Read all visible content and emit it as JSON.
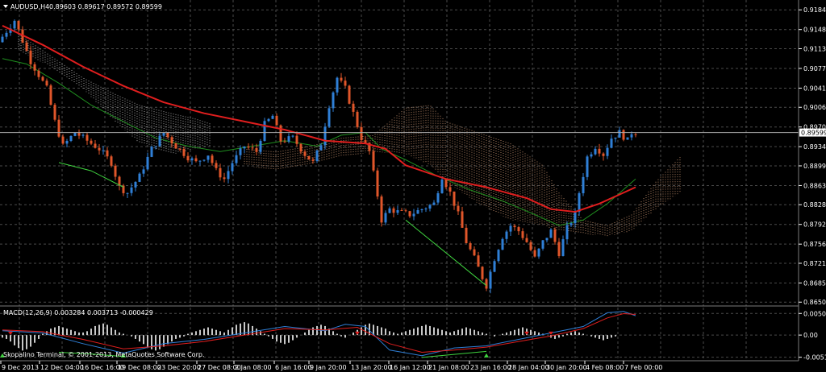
{
  "colors": {
    "background": "#000000",
    "grid": "#4a4a4a",
    "bull": "#2f7fd6",
    "bear": "#e0562a",
    "red_ma": "#e01e1e",
    "green_ma": "#1f8f1f",
    "cloud_a": "#c9c9c9",
    "cloud_b": "#d9a07a",
    "macd_line": "#2f7fd6",
    "signal_line": "#e01e1e",
    "histogram": "#c8c8c8",
    "divergence": "#3fd33f",
    "current_price_line": "#aaaaaa"
  },
  "header": {
    "menu_icon": "triangle-down-icon",
    "symbol": "AUDUSD,H4",
    "ohlc": "0.89603 0.89617 0.89572 0.89599"
  },
  "macd_label": "MACD(12,26,9) 0.003284 0.003713 -0.000429",
  "copyright": "Skopalino Terminal, © 2001-2013, MetaQuotes Software Corp.",
  "chart_data": {
    "type": "candlestick",
    "symbol": "AUDUSD",
    "timeframe": "H4",
    "price_axis_ticks": [
      "0.91840",
      "0.91480",
      "0.91130",
      "0.90770",
      "0.90410",
      "0.90060",
      "0.89700",
      "0.89340",
      "0.88990",
      "0.88630",
      "0.88280",
      "0.87920",
      "0.87560",
      "0.87210",
      "0.86850",
      "0.86500"
    ],
    "price_range": [
      0.8643,
      0.9202
    ],
    "current_price": "0.89599",
    "macd_axis_ticks": [
      "0.00504",
      "0.00",
      "-0.00516"
    ],
    "macd_range": [
      -0.0056,
      0.0064
    ],
    "time_axis_labels": [
      "9 Dec 2013",
      "12 Dec 04:00",
      "16 Dec 16:00",
      "19 Dec 08:00",
      "23 Dec 20:00",
      "27 Dec 08:00",
      "2 Jan 08:00",
      "6 Jan 16:00",
      "9 Jan 20:00",
      "13 Jan 20:00",
      "16 Jan 12:00",
      "21 Jan 08:00",
      "23 Jan 16:00",
      "28 Jan 04:00",
      "30 Jan 20:00",
      "4 Feb 08:00",
      "7 Feb 00:00"
    ],
    "price_path": [
      [
        0,
        0.9125
      ],
      [
        4,
        0.9165
      ],
      [
        8,
        0.909
      ],
      [
        12,
        0.904
      ],
      [
        14,
        0.898
      ],
      [
        16,
        0.8935
      ],
      [
        19,
        0.896
      ],
      [
        22,
        0.8945
      ],
      [
        25,
        0.893
      ],
      [
        28,
        0.8905
      ],
      [
        30,
        0.886
      ],
      [
        32,
        0.885
      ],
      [
        35,
        0.888
      ],
      [
        38,
        0.893
      ],
      [
        41,
        0.896
      ],
      [
        44,
        0.8935
      ],
      [
        47,
        0.8915
      ],
      [
        49,
        0.8905
      ],
      [
        52,
        0.892
      ],
      [
        54,
        0.889
      ],
      [
        56,
        0.8875
      ],
      [
        58,
        0.8905
      ],
      [
        61,
        0.8935
      ],
      [
        64,
        0.8925
      ],
      [
        66,
        0.8975
      ],
      [
        68,
        0.899
      ],
      [
        70,
        0.8945
      ],
      [
        73,
        0.895
      ],
      [
        76,
        0.892
      ],
      [
        78,
        0.8905
      ],
      [
        80,
        0.894
      ],
      [
        82,
        0.901
      ],
      [
        84,
        0.906
      ],
      [
        86,
        0.904
      ],
      [
        88,
        0.8995
      ],
      [
        90,
        0.895
      ],
      [
        92,
        0.8925
      ],
      [
        94,
        0.8845
      ],
      [
        95,
        0.88
      ],
      [
        97,
        0.882
      ],
      [
        99,
        0.8815
      ],
      [
        102,
        0.881
      ],
      [
        105,
        0.882
      ],
      [
        108,
        0.883
      ],
      [
        110,
        0.888
      ],
      [
        112,
        0.885
      ],
      [
        114,
        0.881
      ],
      [
        116,
        0.876
      ],
      [
        118,
        0.873
      ],
      [
        120,
        0.8695
      ],
      [
        121,
        0.868
      ],
      [
        123,
        0.873
      ],
      [
        125,
        0.877
      ],
      [
        127,
        0.879
      ],
      [
        129,
        0.878
      ],
      [
        131,
        0.876
      ],
      [
        133,
        0.873
      ],
      [
        135,
        0.876
      ],
      [
        137,
        0.878
      ],
      [
        139,
        0.874
      ],
      [
        141,
        0.8785
      ],
      [
        143,
        0.881
      ],
      [
        144,
        0.885
      ],
      [
        146,
        0.8915
      ],
      [
        148,
        0.8935
      ],
      [
        150,
        0.892
      ],
      [
        152,
        0.895
      ],
      [
        154,
        0.896
      ],
      [
        156,
        0.8945
      ],
      [
        157,
        0.896
      ]
    ],
    "red_ma": [
      [
        0,
        0.9155
      ],
      [
        10,
        0.912
      ],
      [
        20,
        0.908
      ],
      [
        30,
        0.9045
      ],
      [
        40,
        0.9015
      ],
      [
        50,
        0.8995
      ],
      [
        60,
        0.898
      ],
      [
        70,
        0.8965
      ],
      [
        80,
        0.8945
      ],
      [
        90,
        0.894
      ],
      [
        95,
        0.893
      ],
      [
        100,
        0.89
      ],
      [
        110,
        0.8875
      ],
      [
        120,
        0.886
      ],
      [
        130,
        0.884
      ],
      [
        136,
        0.882
      ],
      [
        142,
        0.8815
      ],
      [
        148,
        0.883
      ],
      [
        157,
        0.886
      ]
    ],
    "green_ma": [
      [
        0,
        0.9095
      ],
      [
        6,
        0.9085
      ],
      [
        14,
        0.905
      ],
      [
        22,
        0.901
      ],
      [
        30,
        0.898
      ],
      [
        38,
        0.895
      ],
      [
        46,
        0.8935
      ],
      [
        54,
        0.8925
      ],
      [
        62,
        0.8935
      ],
      [
        70,
        0.8945
      ],
      [
        78,
        0.8935
      ],
      [
        84,
        0.8955
      ],
      [
        90,
        0.896
      ],
      [
        94,
        0.893
      ],
      [
        100,
        0.891
      ],
      [
        108,
        0.888
      ],
      [
        116,
        0.8855
      ],
      [
        124,
        0.8835
      ],
      [
        132,
        0.881
      ],
      [
        138,
        0.879
      ],
      [
        144,
        0.88
      ],
      [
        150,
        0.883
      ],
      [
        157,
        0.8875
      ]
    ],
    "cloud_a_upper": [
      [
        4,
        0.914
      ],
      [
        12,
        0.91
      ],
      [
        20,
        0.906
      ],
      [
        28,
        0.903
      ],
      [
        34,
        0.901
      ],
      [
        42,
        0.8995
      ],
      [
        48,
        0.8985
      ],
      [
        52,
        0.8975
      ]
    ],
    "cloud_a_lower": [
      [
        4,
        0.911
      ],
      [
        12,
        0.908
      ],
      [
        20,
        0.904
      ],
      [
        28,
        0.898
      ],
      [
        34,
        0.894
      ],
      [
        42,
        0.892
      ],
      [
        48,
        0.893
      ],
      [
        52,
        0.8935
      ]
    ],
    "cloud_b_upper": [
      [
        60,
        0.893
      ],
      [
        68,
        0.8925
      ],
      [
        76,
        0.8935
      ],
      [
        84,
        0.895
      ],
      [
        92,
        0.8955
      ],
      [
        100,
        0.9005
      ],
      [
        106,
        0.901
      ],
      [
        110,
        0.898
      ],
      [
        118,
        0.896
      ],
      [
        126,
        0.894
      ],
      [
        134,
        0.89
      ],
      [
        138,
        0.885
      ],
      [
        144,
        0.88
      ],
      [
        150,
        0.879
      ],
      [
        156,
        0.881
      ],
      [
        162,
        0.887
      ],
      [
        168,
        0.8915
      ]
    ],
    "cloud_b_lower": [
      [
        60,
        0.89
      ],
      [
        68,
        0.889
      ],
      [
        76,
        0.89
      ],
      [
        84,
        0.8915
      ],
      [
        92,
        0.8925
      ],
      [
        100,
        0.892
      ],
      [
        106,
        0.89
      ],
      [
        110,
        0.887
      ],
      [
        118,
        0.883
      ],
      [
        126,
        0.88
      ],
      [
        134,
        0.879
      ],
      [
        138,
        0.878
      ],
      [
        144,
        0.8775
      ],
      [
        150,
        0.877
      ],
      [
        156,
        0.878
      ],
      [
        162,
        0.882
      ],
      [
        168,
        0.885
      ]
    ],
    "divergence_price": [
      [
        [
          14,
          0.8905
        ],
        [
          22,
          0.889
        ],
        [
          30,
          0.886
        ]
      ],
      [
        [
          100,
          0.88
        ],
        [
          120,
          0.868
        ]
      ]
    ],
    "macd_line": [
      [
        0,
        0.001
      ],
      [
        10,
        0.0005
      ],
      [
        20,
        -0.002
      ],
      [
        30,
        -0.0042
      ],
      [
        40,
        -0.002
      ],
      [
        50,
        -0.001
      ],
      [
        60,
        0.0005
      ],
      [
        70,
        0.002
      ],
      [
        80,
        0.001
      ],
      [
        85,
        0.0025
      ],
      [
        90,
        0.002
      ],
      [
        96,
        -0.0035
      ],
      [
        104,
        -0.0048
      ],
      [
        112,
        -0.003
      ],
      [
        120,
        -0.0025
      ],
      [
        128,
        -0.001
      ],
      [
        136,
        0.0005
      ],
      [
        144,
        0.002
      ],
      [
        150,
        0.0052
      ],
      [
        154,
        0.0055
      ],
      [
        157,
        0.0045
      ]
    ],
    "signal_line": [
      [
        0,
        0.0012
      ],
      [
        10,
        0.0008
      ],
      [
        20,
        -0.001
      ],
      [
        30,
        -0.0032
      ],
      [
        40,
        -0.0025
      ],
      [
        50,
        -0.0015
      ],
      [
        60,
        0.0
      ],
      [
        70,
        0.0015
      ],
      [
        80,
        0.0012
      ],
      [
        88,
        0.0018
      ],
      [
        96,
        -0.002
      ],
      [
        104,
        -0.004
      ],
      [
        112,
        -0.0035
      ],
      [
        120,
        -0.0028
      ],
      [
        128,
        -0.0015
      ],
      [
        136,
        -0.0002
      ],
      [
        144,
        0.0015
      ],
      [
        150,
        0.004
      ],
      [
        154,
        0.005
      ],
      [
        157,
        0.0048
      ]
    ],
    "histogram": [
      -0.0002,
      -0.0003,
      -0.0005,
      -0.0008,
      -0.001,
      -0.0012,
      -0.0011,
      -0.0009,
      -0.0006,
      -0.0003,
      0.0001,
      0.0003,
      0.0005,
      0.0006,
      0.0007,
      0.0006,
      0.0005,
      0.0004,
      0.0003,
      0.0002,
      0.0002,
      0.0003,
      0.0005,
      0.0007,
      0.0008,
      0.0009,
      0.0008,
      0.0006,
      0.0004,
      0.0002,
      0.0001,
      0.0,
      -0.0001,
      -0.0003,
      -0.0005,
      -0.0007,
      -0.0009,
      -0.0011,
      -0.0012,
      -0.0011,
      -0.0009,
      -0.0007,
      -0.0005,
      -0.0003,
      -0.0002,
      -0.0001,
      0.0001,
      0.0002,
      0.0003,
      0.0004,
      0.0005,
      0.0006,
      0.0005,
      0.0004,
      0.0003,
      0.0002,
      0.0004,
      0.0006,
      0.0008,
      0.0009,
      0.001,
      0.0009,
      0.0007,
      0.0005,
      0.0003,
      0.0001,
      -0.0001,
      -0.0003,
      -0.0005,
      -0.0006,
      -0.0007,
      -0.0006,
      -0.0004,
      -0.0002,
      0.0,
      0.0002,
      0.0004,
      0.0006,
      0.0007,
      0.0008,
      0.0007,
      0.0005,
      0.0003,
      0.0001,
      -0.0001,
      -0.0002,
      0.0,
      0.0002,
      0.0004,
      0.0006,
      0.0008,
      0.0009,
      0.0008,
      0.0007,
      0.0006,
      0.0005,
      0.0003,
      0.0002,
      0.0001,
      0.0002,
      0.0003,
      0.0004,
      0.0005,
      0.0006,
      0.0007,
      0.0008,
      0.0007,
      0.0006,
      0.0005,
      0.0004,
      0.0003,
      0.0002,
      0.0003,
      0.0004,
      0.0005,
      0.0006,
      0.0005,
      0.0004,
      0.0003,
      0.0002,
      0.0001,
      0.0,
      -0.0001,
      0.0,
      0.0001,
      0.0002,
      0.0003,
      0.0004,
      0.0005,
      0.0006,
      0.0005,
      0.0004,
      0.0003,
      0.0002,
      0.0001,
      0.0,
      -0.0002,
      -0.0003,
      -0.0002,
      -0.0001,
      0.0001,
      0.0002,
      0.0003,
      0.0002,
      0.0001,
      0.0,
      -0.0001,
      -0.0002,
      -0.0003,
      -0.0004,
      -0.0003,
      -0.0002,
      -0.0001
    ],
    "divergence_macd": [
      [
        [
          14,
          -0.004
        ],
        [
          22,
          -0.0044
        ],
        [
          30,
          -0.005
        ]
      ],
      [
        [
          104,
          -0.0052
        ],
        [
          120,
          -0.0038
        ]
      ]
    ],
    "markers": [
      {
        "bar": 0,
        "type": "up",
        "color": "#3fd33f"
      },
      {
        "bar": 30,
        "type": "up",
        "color": "#3fd33f"
      },
      {
        "bar": 120,
        "type": "up",
        "color": "#3fd33f"
      },
      {
        "bar": 2,
        "type": "down",
        "color": "#e01e1e"
      },
      {
        "bar": 88,
        "type": "down",
        "color": "#e01e1e"
      },
      {
        "bar": 130,
        "type": "down",
        "color": "#e01e1e"
      },
      {
        "bar": 136,
        "type": "down",
        "color": "#e01e1e"
      }
    ]
  }
}
